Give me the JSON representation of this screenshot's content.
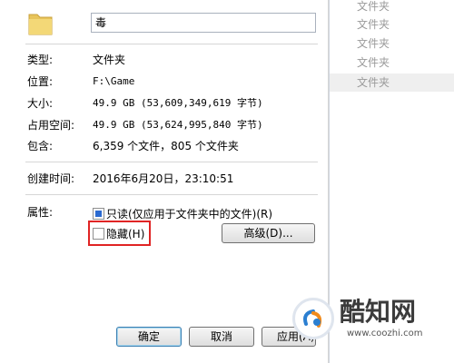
{
  "dialog": {
    "folder_name": "毒",
    "properties": [
      {
        "label": "类型:",
        "value": "文件夹"
      },
      {
        "label": "位置:",
        "value": "F:\\Game"
      },
      {
        "label": "大小:",
        "value": "49.9 GB (53,609,349,619 字节)"
      },
      {
        "label": "占用空间:",
        "value": "49.9 GB (53,624,995,840 字节)"
      },
      {
        "label": "包含:",
        "value": "6,359 个文件，805 个文件夹"
      },
      {
        "label": "创建时间:",
        "value": "2016年6月20日，23:10:51"
      }
    ],
    "attributes_label": "属性:",
    "readonly_label": "只读(仅应用于文件夹中的文件)(R)",
    "hidden_label": "隐藏(H)",
    "advanced_button": "高级(D)...",
    "ok_button": "确定",
    "cancel_button": "取消",
    "apply_button": "应用(A)"
  },
  "right_pane": {
    "items": [
      "文件夹",
      "文件夹",
      "文件夹",
      "文件夹",
      "文件夹"
    ]
  },
  "watermark": {
    "title": "酷知网",
    "url": "www.coozhi.com"
  },
  "colors": {
    "checkbox_fill": "#2b6ad1",
    "highlight_border": "#e02424",
    "default_button_border": "#3c7fb1"
  }
}
